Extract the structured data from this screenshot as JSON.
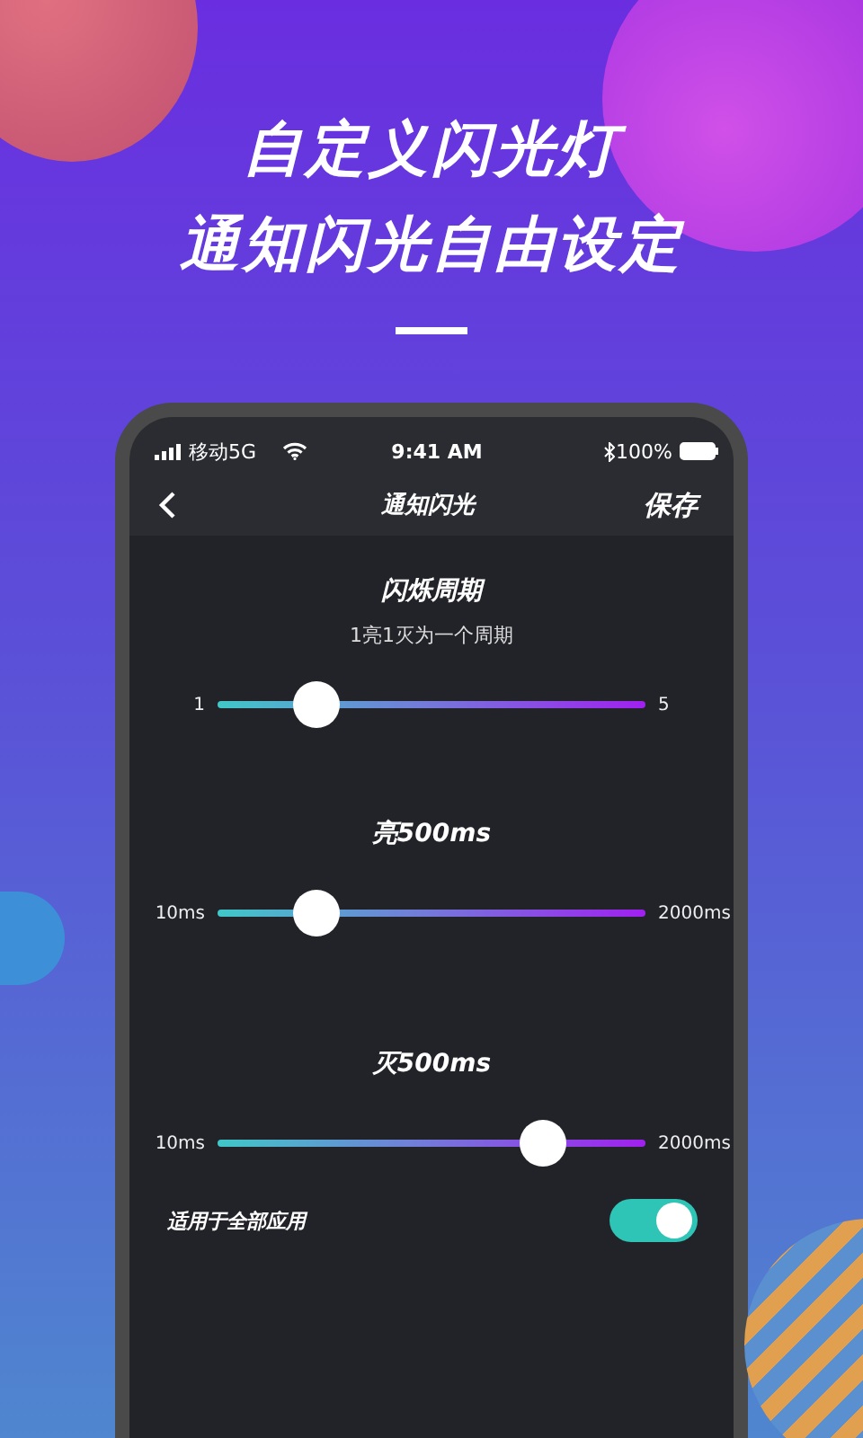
{
  "headline": [
    "自定义闪光灯",
    "通知闪光自由设定"
  ],
  "status_bar": {
    "carrier": "移动5G",
    "time": "9:41 AM",
    "battery": "100%"
  },
  "nav": {
    "title": "通知闪光",
    "action": "保存"
  },
  "sliders": [
    {
      "title": "闪烁周期",
      "subtitle": "1亮1灭为一个周期",
      "min_label": "1",
      "max_label": "5",
      "level": 0.23
    },
    {
      "title": "亮500ms",
      "min_label": "10ms",
      "max_label": "2000ms",
      "level": 0.23
    },
    {
      "title": "灭500ms",
      "min_label": "10ms",
      "max_label": "2000ms",
      "level": 0.76
    }
  ],
  "toggle": {
    "label": "适用于全部应用",
    "on": true
  }
}
